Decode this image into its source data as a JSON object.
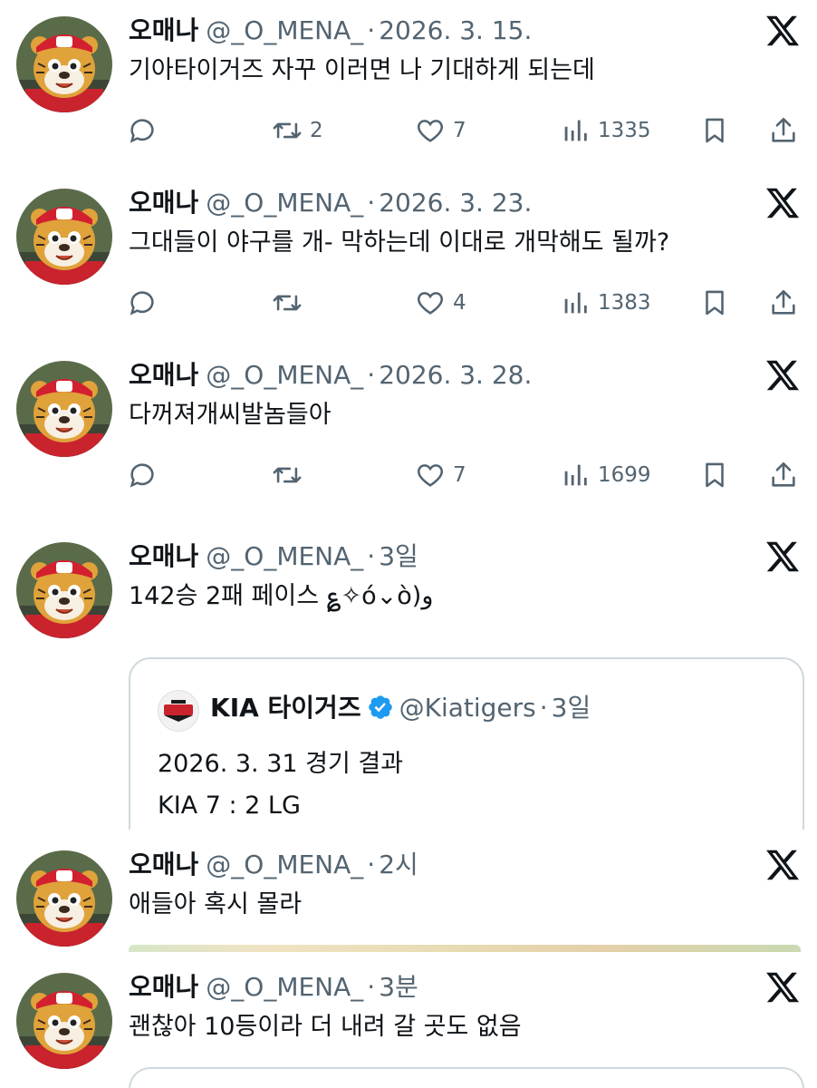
{
  "colors": {
    "text": "#0f1419",
    "muted": "#536471",
    "border": "#cfd9de",
    "verified": "#1d9bf0"
  },
  "tweets": [
    {
      "name": "오매나",
      "handle": "@_O_MENA_",
      "dot": "·",
      "time": "2026. 3. 15.",
      "text": "기아타이거즈 자꾸 이러면 나 기대하게 되는데",
      "retweets": "2",
      "likes": "7",
      "views": "1335"
    },
    {
      "name": "오매나",
      "handle": "@_O_MENA_",
      "dot": "·",
      "time": "2026. 3. 23.",
      "text": "그대들이 야구를 개- 막하는데 이대로 개막해도 될까?",
      "retweets": "",
      "likes": "4",
      "views": "1383"
    },
    {
      "name": "오매나",
      "handle": "@_O_MENA_",
      "dot": "·",
      "time": "2026. 3. 28.",
      "text": "다꺼져개씨발놈들아",
      "retweets": "",
      "likes": "7",
      "views": "1699"
    },
    {
      "name": "오매나",
      "handle": "@_O_MENA_",
      "dot": "·",
      "time": "3일",
      "text": "142승 2패 페이스 ؏✧ó⌄ò)و",
      "quote": {
        "name": "KIA 타이거즈",
        "handle": "@Kiatigers",
        "dot": "·",
        "time": "3일",
        "line1": "2026. 3. 31 경기 결과",
        "line2": "KIA 7 : 2 LG"
      }
    },
    {
      "name": "오매나",
      "handle": "@_O_MENA_",
      "dot": "·",
      "time": "2시",
      "text": "애들아 혹시 몰라"
    },
    {
      "name": "오매나",
      "handle": "@_O_MENA_",
      "dot": "·",
      "time": "3분",
      "text": "괜찮아 10등이라 더 내려 갈 곳도 없음"
    }
  ],
  "icons": [
    "reply-icon",
    "retweet-icon",
    "like-icon",
    "views-icon",
    "bookmark-icon",
    "share-icon",
    "x-logo-icon",
    "verified-icon"
  ]
}
